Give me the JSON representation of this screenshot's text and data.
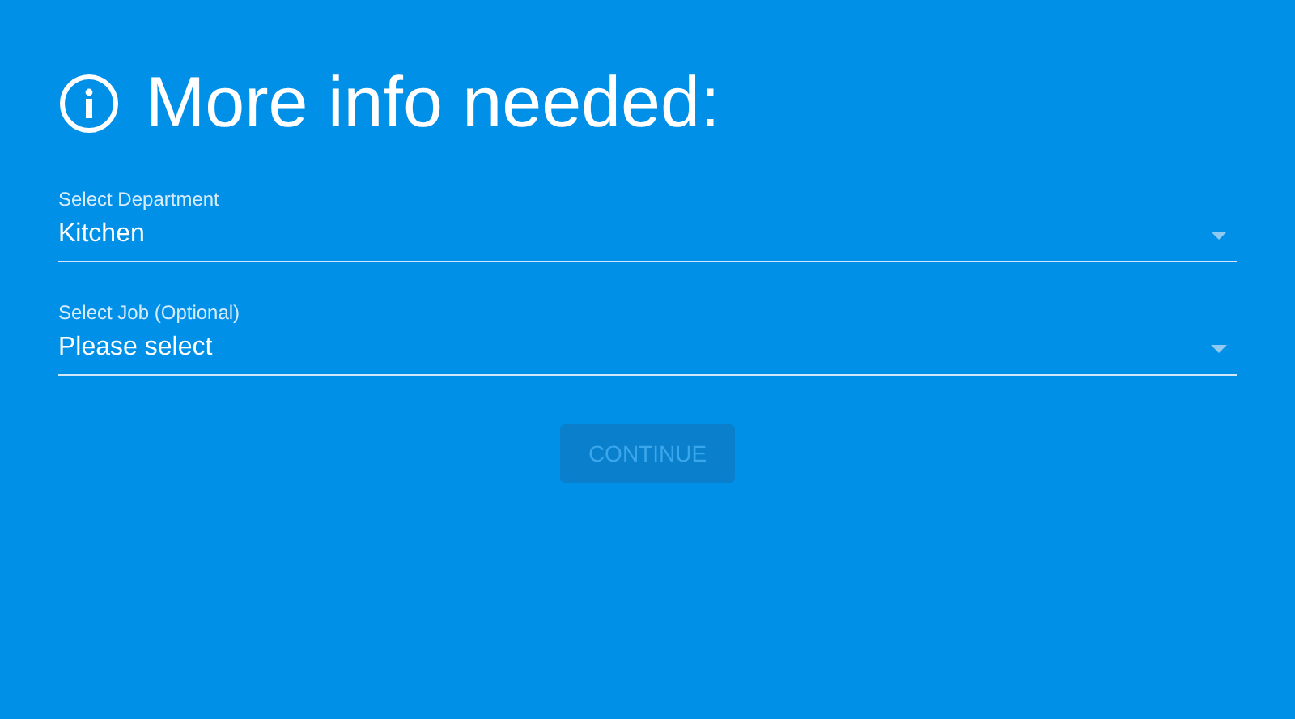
{
  "heading": {
    "title": "More info needed:"
  },
  "fields": [
    {
      "label": "Select Department",
      "value": "Kitchen"
    },
    {
      "label": "Select Job (Optional)",
      "placeholder": "Please select"
    }
  ],
  "button": {
    "label": "CONTINUE",
    "disabled": true
  }
}
